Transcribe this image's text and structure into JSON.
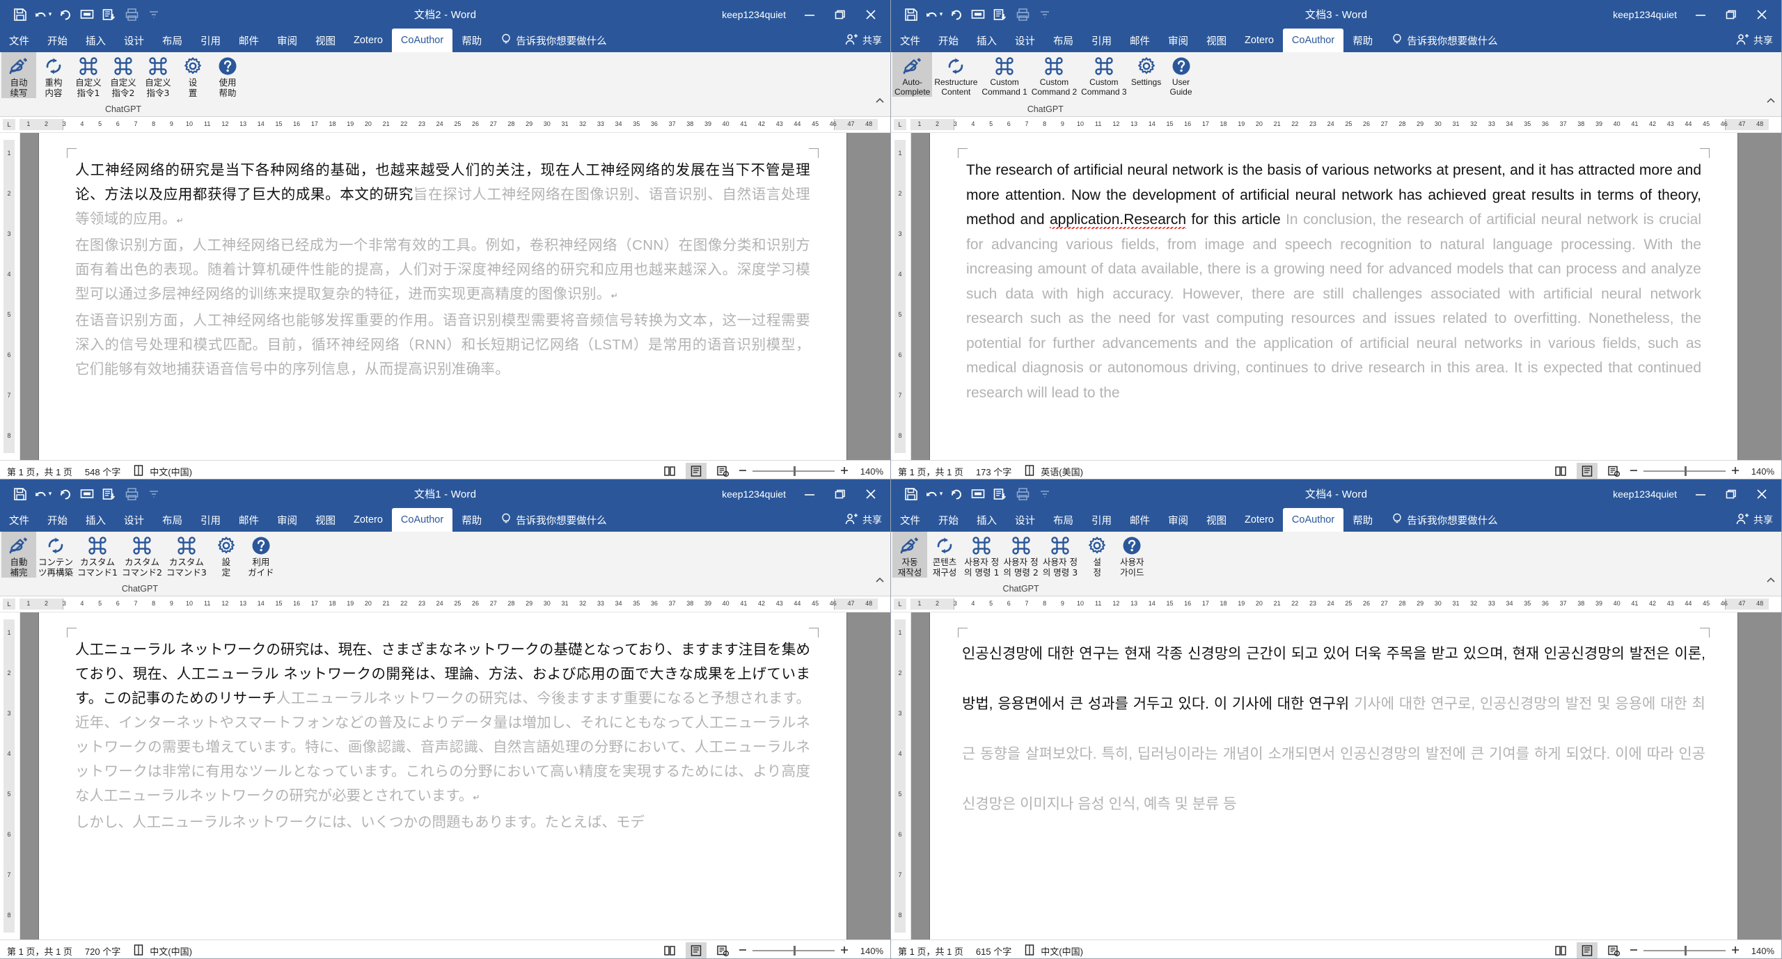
{
  "theme": {
    "accent": "#2b579a",
    "ribbon_bg": "#f3f3f3",
    "gray_text": "#b3b3b3",
    "body_text": "#111111",
    "spellcheck_underline": "#e53935"
  },
  "account_name": "keep1234quiet",
  "common": {
    "share_label": "共享",
    "tellme_zh": "告诉我你想要做什么",
    "group_title": "ChatGPT",
    "win_min": "minimize",
    "win_max": "restore",
    "win_close": "close"
  },
  "windows": [
    {
      "id": "top-left",
      "title": "文档2  -  Word",
      "lang_ui": "zh",
      "tabs": [
        "文件",
        "开始",
        "插入",
        "设计",
        "布局",
        "引用",
        "邮件",
        "审阅",
        "视图",
        "Zotero",
        "CoAuthor",
        "帮助"
      ],
      "active_tab": "CoAuthor",
      "tellme": "告诉我你想要做什么",
      "share": "共享",
      "ribbon": {
        "group_title": "ChatGPT",
        "buttons": [
          {
            "name": "auto-complete",
            "icon": "pen-write-icon",
            "label": "自动\n续写",
            "selected": true
          },
          {
            "name": "restructure-content",
            "icon": "refresh-cycle-icon",
            "label": "重构\n内容",
            "selected": false
          },
          {
            "name": "custom-command-1",
            "icon": "command-icon",
            "label": "自定义\n指令1",
            "selected": false
          },
          {
            "name": "custom-command-2",
            "icon": "command-icon",
            "label": "自定义\n指令2",
            "selected": false
          },
          {
            "name": "custom-command-3",
            "icon": "command-icon",
            "label": "自定义\n指令3",
            "selected": false
          },
          {
            "name": "settings",
            "icon": "gear-icon",
            "label": "设\n置",
            "selected": false
          },
          {
            "name": "user-guide",
            "icon": "question-circle-icon",
            "label": "使用\n帮助",
            "selected": false
          }
        ]
      },
      "document": {
        "script": "zh",
        "paragraphs": [
          {
            "runs": [
              {
                "text": "人工神经网络的研究是当下各种网络的基础，也越来越受人们的关注，现在人工神经网络的发展在当下不管是理论、方法以及应用都获得了巨大的成果。本文的研究",
                "style": "black"
              },
              {
                "text": "旨在探讨人工神经网络在图像识别、语音识别、自然语言处理等领域的应用。",
                "style": "gray"
              },
              {
                "text": "↵",
                "style": "pilcrow"
              }
            ]
          },
          {
            "runs": [
              {
                "text": "在图像识别方面，人工神经网络已经成为一个非常有效的工具。例如，卷积神经网络（CNN）在图像分类和识别方面有着出色的表现。随着计算机硬件性能的提高，人们对于深度神经网络的研究和应用也越来越深入。深度学习模型可以通过多层神经网络的训练来提取复杂的特征，进而实现更高精度的图像识别。",
                "style": "gray"
              },
              {
                "text": "↵",
                "style": "pilcrow"
              }
            ]
          },
          {
            "runs": [
              {
                "text": "在语音识别方面，人工神经网络也能够发挥重要的作用。语音识别模型需要将音频信号转换为文本，这一过程需要深入的信号处理和模式匹配。目前，循环神经网络（RNN）和长短期记忆网络（LSTM）是常用的语音识别模型，它们能够有效地捕获语音信号中的序列信息，从而提高识别准确率。",
                "style": "gray"
              }
            ]
          }
        ]
      },
      "status": {
        "page": "第 1 页，共 1 页",
        "words": "548 个字",
        "language": "中文(中国)",
        "zoom": "140%"
      }
    },
    {
      "id": "top-right",
      "title": "文档3  -  Word",
      "lang_ui": "en",
      "tabs": [
        "文件",
        "开始",
        "插入",
        "设计",
        "布局",
        "引用",
        "邮件",
        "审阅",
        "视图",
        "Zotero",
        "CoAuthor",
        "帮助"
      ],
      "active_tab": "CoAuthor",
      "tellme": "告诉我你想要做什么",
      "share": "共享",
      "ribbon": {
        "group_title": "ChatGPT",
        "buttons": [
          {
            "name": "auto-complete",
            "icon": "pen-write-icon",
            "label": "Auto-\nComplete",
            "selected": true
          },
          {
            "name": "restructure-content",
            "icon": "refresh-cycle-icon",
            "label": "Restructure\nContent",
            "selected": false
          },
          {
            "name": "custom-command-1",
            "icon": "command-icon",
            "label": "Custom\nCommand 1",
            "selected": false
          },
          {
            "name": "custom-command-2",
            "icon": "command-icon",
            "label": "Custom\nCommand 2",
            "selected": false
          },
          {
            "name": "custom-command-3",
            "icon": "command-icon",
            "label": "Custom\nCommand 3",
            "selected": false
          },
          {
            "name": "settings",
            "icon": "gear-icon",
            "label": "Settings",
            "selected": false
          },
          {
            "name": "user-guide",
            "icon": "question-circle-icon",
            "label": "User\nGuide",
            "selected": false
          }
        ]
      },
      "document": {
        "script": "en",
        "paragraphs": [
          {
            "runs": [
              {
                "text": "The research of artificial neural network is the basis of various networks at present, and it has attracted more and more attention. Now the development of artificial neural network has achieved great results in terms of theory, method and ",
                "style": "black"
              },
              {
                "text": "application.Research",
                "style": "black-spell"
              },
              {
                "text": " for this article ",
                "style": "black"
              },
              {
                "text": "In conclusion, the research of artificial neural network is crucial for advancing various fields, from image and speech recognition to natural language processing. With the increasing amount of data available, there is a growing need for advanced models that can process and analyze such data with high accuracy. However, there are still challenges associated with artificial neural network research such as the need for vast computing resources and issues related to overfitting. Nonetheless, the potential for further advancements and the application of artificial neural networks in various fields, such as medical diagnosis or autonomous driving, continues to drive research in this area. It is expected that continued research will lead to the",
                "style": "gray"
              }
            ]
          }
        ]
      },
      "status": {
        "page": "第 1 页，共 1 页",
        "words": "173 个字",
        "language": "英语(美国)",
        "zoom": "140%"
      }
    },
    {
      "id": "bottom-left",
      "title": "文档1  -  Word",
      "lang_ui": "ja",
      "tabs": [
        "文件",
        "开始",
        "插入",
        "设计",
        "布局",
        "引用",
        "邮件",
        "审阅",
        "视图",
        "Zotero",
        "CoAuthor",
        "帮助"
      ],
      "active_tab": "CoAuthor",
      "tellme": "告诉我你想要做什么",
      "share": "共享",
      "ribbon": {
        "group_title": "ChatGPT",
        "buttons": [
          {
            "name": "auto-complete",
            "icon": "pen-write-icon",
            "label": "自動\n補完",
            "selected": true
          },
          {
            "name": "restructure-content",
            "icon": "refresh-cycle-icon",
            "label": "コンテン\nツ再構築",
            "selected": false
          },
          {
            "name": "custom-command-1",
            "icon": "command-icon",
            "label": "カスタム\nコマンド1",
            "selected": false
          },
          {
            "name": "custom-command-2",
            "icon": "command-icon",
            "label": "カスタム\nコマンド2",
            "selected": false
          },
          {
            "name": "custom-command-3",
            "icon": "command-icon",
            "label": "カスタム\nコマンド3",
            "selected": false
          },
          {
            "name": "settings",
            "icon": "gear-icon",
            "label": "設\n定",
            "selected": false
          },
          {
            "name": "user-guide",
            "icon": "question-circle-icon",
            "label": "利用\nガイド",
            "selected": false
          }
        ]
      },
      "document": {
        "script": "ja",
        "paragraphs": [
          {
            "runs": [
              {
                "text": "人工ニューラル ネットワークの研究は、現在、さまざまなネットワークの基礎となっており、ますます注目を集めており、現在、人工ニューラル ネットワークの開発は、理論、方法、および応用の面で大きな成果を上げています。この記事のためのリサーチ",
                "style": "black"
              },
              {
                "text": "人工ニューラルネットワークの研究は、今後ますます重要になると予想されます。近年、インターネットやスマートフォンなどの普及によりデータ量は増加し、それにともなって人工ニューラルネットワークの需要も増えています。特に、画像認識、音声認識、自然言語処理の分野において、人工ニューラルネットワークは非常に有用なツールとなっています。これらの分野において高い精度を実現するためには、より高度な人工ニューラルネットワークの研究が必要とされています。",
                "style": "gray"
              },
              {
                "text": "↵",
                "style": "pilcrow"
              }
            ]
          },
          {
            "runs": [
              {
                "text": "しかし、人工ニューラルネットワークには、いくつかの問題もあります。たとえば、モデ",
                "style": "gray"
              }
            ]
          }
        ]
      },
      "status": {
        "page": "第 1 页，共 1 页",
        "words": "720 个字",
        "language": "中文(中国)",
        "zoom": "140%"
      }
    },
    {
      "id": "bottom-right",
      "title": "文档4  -  Word",
      "lang_ui": "ko",
      "tabs": [
        "文件",
        "开始",
        "插入",
        "设计",
        "布局",
        "引用",
        "邮件",
        "审阅",
        "视图",
        "Zotero",
        "CoAuthor",
        "帮助"
      ],
      "active_tab": "CoAuthor",
      "tellme": "告诉我你想要做什么",
      "share": "共享",
      "ribbon": {
        "group_title": "ChatGPT",
        "buttons": [
          {
            "name": "auto-complete",
            "icon": "pen-write-icon",
            "label": "자동\n재작성",
            "selected": true
          },
          {
            "name": "restructure-content",
            "icon": "refresh-cycle-icon",
            "label": "콘텐츠\n재구성",
            "selected": false
          },
          {
            "name": "custom-command-1",
            "icon": "command-icon",
            "label": "사용자 정\n의 명령 1",
            "selected": false
          },
          {
            "name": "custom-command-2",
            "icon": "command-icon",
            "label": "사용자 정\n의 명령 2",
            "selected": false
          },
          {
            "name": "custom-command-3",
            "icon": "command-icon",
            "label": "사용자 정\n의 명령 3",
            "selected": false
          },
          {
            "name": "settings",
            "icon": "gear-icon",
            "label": "설\n정",
            "selected": false
          },
          {
            "name": "user-guide",
            "icon": "question-circle-icon",
            "label": "사용자\n가이드",
            "selected": false
          }
        ]
      },
      "document": {
        "script": "ko",
        "paragraphs": [
          {
            "runs": [
              {
                "text": "인공신경망에 대한 연구는 현재 각종 신경망의 근간이 되고 있어 더욱 주목을 받고 있으며, 현재 인공신경망의 발전은 이론, 방법, 응용면에서 큰 성과를 거두고 있다. 이 기사에 대한 연구위",
                "style": "black"
              },
              {
                "text": " 기사에 대한 연구로, 인공신경망의 발전 및 응용에 대한 최근 동향을 살펴보았다. 특히, 딥러닝이라는 개념이 소개되면서 인공신경망의 발전에 큰 기여를 하게 되었다. 이에 따라 인공신경망은 이미지나 음성 인식, 예측 및 분류 등",
                "style": "gray"
              }
            ]
          }
        ]
      },
      "status": {
        "page": "第 1 页，共 1 页",
        "words": "615 个字",
        "language": "中文(中国)",
        "zoom": "140%"
      }
    }
  ],
  "ruler": {
    "left_marks": [
      "1",
      "1"
    ],
    "ticks": [
      "1",
      "2",
      "3",
      "4",
      "5",
      "6",
      "7",
      "8",
      "9",
      "10",
      "11",
      "12",
      "13",
      "14",
      "15",
      "16",
      "17",
      "18",
      "19",
      "20",
      "21",
      "22",
      "23",
      "24",
      "25",
      "26",
      "27",
      "28",
      "29",
      "30",
      "31",
      "32",
      "33",
      "34",
      "35",
      "36",
      "37",
      "38",
      "39",
      "40",
      "41",
      "42",
      "43",
      "44",
      "45",
      "46",
      "47",
      "48"
    ]
  }
}
